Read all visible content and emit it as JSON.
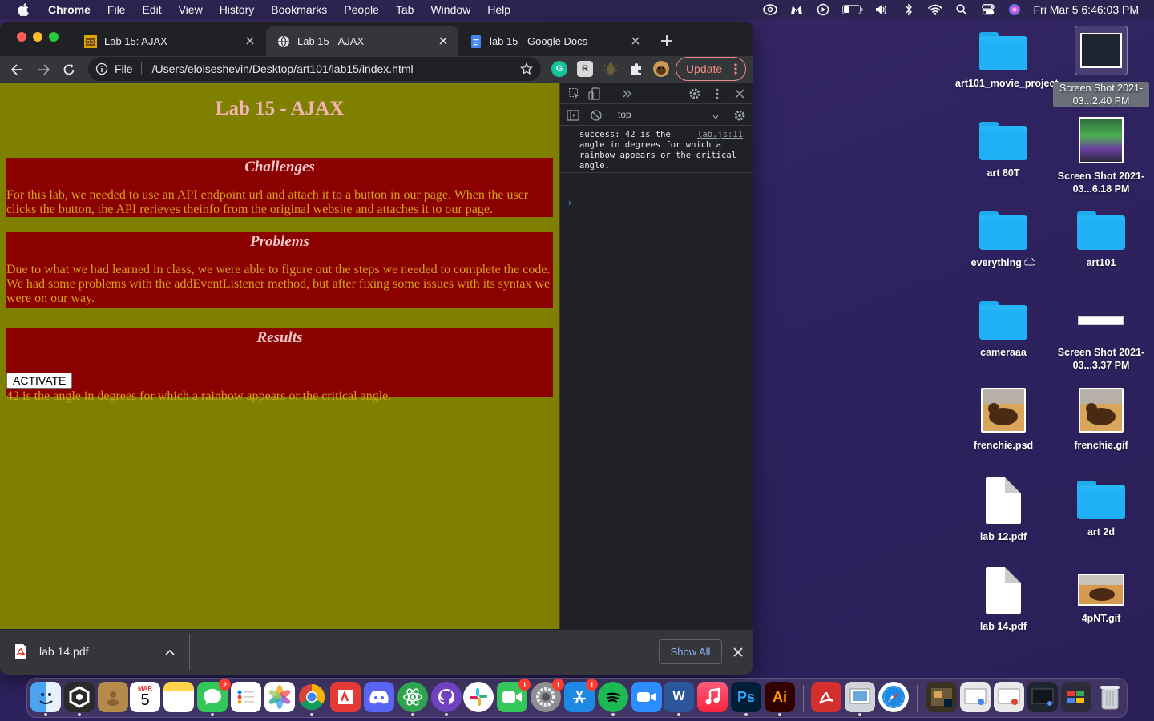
{
  "menubar": {
    "app_name": "Chrome",
    "items": [
      "File",
      "Edit",
      "View",
      "History",
      "Bookmarks",
      "People",
      "Tab",
      "Window",
      "Help"
    ],
    "clock": "Fri Mar 5  6:46:03 PM"
  },
  "browser": {
    "tabs": [
      {
        "title": "Lab 15: AJAX",
        "favicon": "image-favicon",
        "active": false
      },
      {
        "title": "Lab 15 - AJAX",
        "favicon": "globe-icon",
        "active": true
      },
      {
        "title": "lab 15 - Google Docs",
        "favicon": "docs-icon",
        "active": false
      }
    ],
    "omnibox": {
      "scheme": "File",
      "url": "/Users/eloiseshevin/Desktop/art101/lab15/index.html"
    },
    "update_label": "Update",
    "colors": {
      "update": "#f28b82",
      "chrome_bg": "#202124",
      "toolbar": "#35363a"
    }
  },
  "page": {
    "title": "Lab 15 - AJAX",
    "sections": [
      {
        "heading": "Challenges",
        "text": "For this lab, we needed to use an API endpoint url and attach it to a button in our page. When the user clicks the button, the API rerieves theinfo from the original website and attaches it to our page."
      },
      {
        "heading": "Problems",
        "text": "Due to what we had learned in class, we were able to figure out the steps we needed to complete the code. We had some problems with the addEventListener method, but after fixing some issues with its syntax we were on our way."
      },
      {
        "heading": "Results",
        "button_label": "ACTIVATE",
        "text": "42 is the angle in degrees for which a rainbow appears or the critical angle."
      }
    ],
    "colors": {
      "background": "#808000",
      "section_bg": "#8b0000",
      "text": "#d4a020",
      "heading": "#f2b6b6"
    }
  },
  "devtools": {
    "context": "top",
    "message": "success: 42 is the angle in degrees for which a rainbow appears or the critical angle.",
    "source": "lab.js:11",
    "prompt": "›"
  },
  "downloads": {
    "file_name": "lab 14.pdf",
    "show_all_label": "Show All"
  },
  "desktop": {
    "icons": [
      {
        "label": "art101_movie_project",
        "kind": "folder"
      },
      {
        "label": "Screen Shot 2021-03...2.40 PM",
        "kind": "screenshot",
        "selected": true
      },
      {
        "label": "art 80T",
        "kind": "folder"
      },
      {
        "label": "Screen Shot 2021-03...6.18 PM",
        "kind": "screenshot"
      },
      {
        "label": "everything",
        "kind": "folder"
      },
      {
        "label": "art101",
        "kind": "folder"
      },
      {
        "label": "cameraaa",
        "kind": "folder"
      },
      {
        "label": "Screen Shot 2021-03...3.37 PM",
        "kind": "screenshot"
      },
      {
        "label": "frenchie.psd",
        "kind": "image"
      },
      {
        "label": "frenchie.gif",
        "kind": "image"
      },
      {
        "label": "lab 12.pdf",
        "kind": "pdf"
      },
      {
        "label": "art 2d",
        "kind": "folder"
      },
      {
        "label": "lab 14.pdf",
        "kind": "pdf"
      },
      {
        "label": "4pNT.gif",
        "kind": "image"
      }
    ]
  },
  "dock": {
    "calendar_month": "MAR",
    "calendar_day": "5",
    "badges": {
      "messages": "2",
      "facetime": "1",
      "system_preferences": "1",
      "app_store": "1"
    }
  }
}
